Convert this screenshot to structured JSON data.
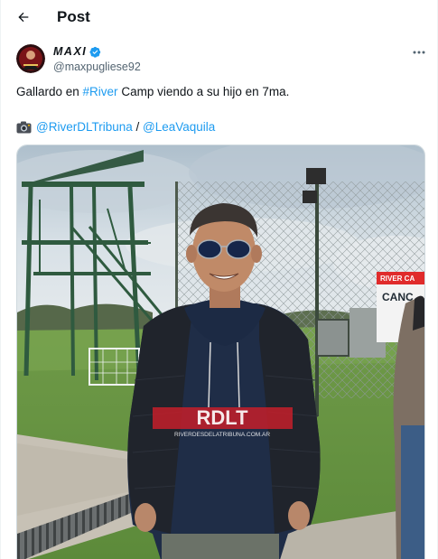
{
  "header": {
    "title": "Post",
    "back_icon": "arrow-left-icon"
  },
  "author": {
    "display_name": "MAXI",
    "handle": "@maxpugliese92",
    "verified": true,
    "verified_color": "#1d9bf0"
  },
  "tweet": {
    "text_before": "Gallardo en ",
    "hashtag": "#River",
    "text_after": " Camp viendo a su hijo en 7ma.",
    "credit_icon": "camera-icon",
    "mention_1": "@RiverDLTribuna",
    "separator": " / ",
    "mention_2": "@LeaVaquila"
  },
  "media": {
    "watermark_title": "RDLT",
    "watermark_url": "RIVERDESDELATRIBUNA.COM.AR",
    "sign_text": "CANC",
    "sign_header": "RIVER CA"
  },
  "colors": {
    "link": "#1d9bf0",
    "secondary": "#536471",
    "text": "#0f1419"
  }
}
